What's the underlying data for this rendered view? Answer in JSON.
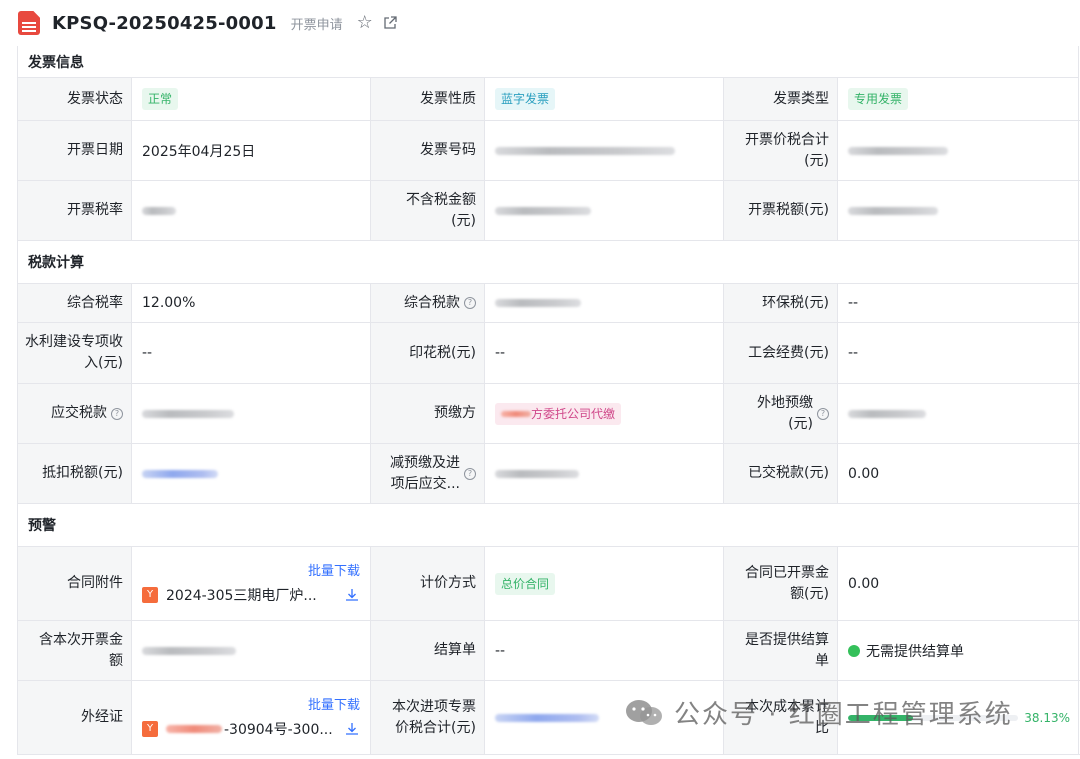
{
  "header": {
    "title": "KPSQ-20250425-0001",
    "subtitle": "开票申请"
  },
  "sections": {
    "invoice_info": "发票信息",
    "tax_calc": "税款计算",
    "warning": "预警"
  },
  "invoice": {
    "status_label": "发票状态",
    "status_value": "正常",
    "nature_label": "发票性质",
    "nature_value": "蓝字发票",
    "type_label": "发票类型",
    "type_value": "专用发票",
    "date_label": "开票日期",
    "date_value": "2025年04月25日",
    "number_label": "发票号码",
    "total_label": "开票价税合计(元)",
    "rate_label": "开票税率",
    "net_label": "不含税金额(元)",
    "tax_label": "开票税额(元)"
  },
  "tax": {
    "comp_rate_label": "综合税率",
    "comp_rate_value": "12.00%",
    "comp_tax_label": "综合税款",
    "env_label": "环保税(元)",
    "env_value": "--",
    "water_label": "水利建设专项收入(元)",
    "water_value": "--",
    "stamp_label": "印花税(元)",
    "stamp_value": "--",
    "union_label": "工会经费(元)",
    "union_value": "--",
    "payable_label": "应交税款",
    "prepay_label": "预缴方",
    "prepay_value": "方委托公司代缴",
    "remote_label": "外地预缴(元)",
    "deduct_label": "抵扣税额(元)",
    "reduce_label": "减预缴及进项后应交...",
    "paid_label": "已交税款(元)",
    "paid_value": "0.00"
  },
  "warning": {
    "contract_att_label": "合同附件",
    "batch_download": "批量下载",
    "contract_file": "2024-305三期电厂炉...",
    "pricing_label": "计价方式",
    "pricing_value": "总价合同",
    "contract_invoiced_label": "合同已开票金额(元)",
    "contract_invoiced_value": "0.00",
    "incl_label": "含本次开票金额",
    "settle_label": "结算单",
    "settle_value": "--",
    "provide_label": "是否提供结算单",
    "provide_value": "无需提供结算单",
    "cert_label": "外经证",
    "cert_file": "-30904号-300...",
    "input_total_label": "本次进项专票价税合计(元)",
    "cost_ratio_label": "本次成本累计比",
    "cost_ratio_value": "38.13%",
    "cost_ratio_fraction": 0.38
  },
  "watermark": {
    "text": "公众号 · 红圈工程管理系统"
  },
  "colors": {
    "green": "#34b368",
    "cyan": "#2a9fbf",
    "pink": "#d0488a",
    "link": "#3370ff",
    "doc_red": "#e8493f"
  }
}
